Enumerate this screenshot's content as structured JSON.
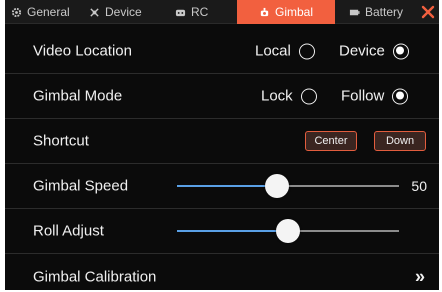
{
  "tabs": [
    {
      "label": "General",
      "icon": "gear-icon",
      "active": false
    },
    {
      "label": "Device",
      "icon": "device-icon",
      "active": false
    },
    {
      "label": "RC",
      "icon": "controller-icon",
      "active": false
    },
    {
      "label": "Gimbal",
      "icon": "gimbal-icon",
      "active": true
    },
    {
      "label": "Battery",
      "icon": "battery-icon",
      "active": false
    }
  ],
  "colors": {
    "accent": "#f2603f",
    "slider": "#5aa0e6",
    "background": "#0b0b0b"
  },
  "settings": {
    "video_location": {
      "label": "Video Location",
      "option1": "Local",
      "option2": "Device",
      "selected": "Device"
    },
    "gimbal_mode": {
      "label": "Gimbal Mode",
      "option1": "Lock",
      "option2": "Follow",
      "selected": "Follow"
    },
    "shortcut": {
      "label": "Shortcut",
      "button1": "Center",
      "button2": "Down"
    },
    "gimbal_speed": {
      "label": "Gimbal Speed",
      "value": "50",
      "level": 0.45
    },
    "roll_adjust": {
      "label": "Roll Adjust",
      "level": 0.5
    },
    "gimbal_calibration": {
      "label": "Gimbal Calibration",
      "chevron": "»"
    }
  }
}
